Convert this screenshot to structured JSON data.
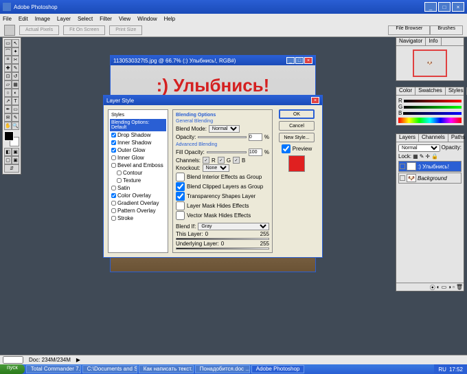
{
  "app": {
    "title": "Adobe Photoshop"
  },
  "menu": [
    "File",
    "Edit",
    "Image",
    "Layer",
    "Select",
    "Filter",
    "View",
    "Window",
    "Help"
  ],
  "optionbar": {
    "btn1": "Actual Pixels",
    "btn2": "Fit On Screen",
    "btn3": "Print Size",
    "tabs": [
      "File Browser",
      "Brushes"
    ]
  },
  "document": {
    "title": "1130530327t5.jpg @ 66.7% (:) Улыбнись!, RGB#)",
    "text": ":) Улыбнись!"
  },
  "dialog": {
    "title": "Layer Style",
    "hdr": "Styles",
    "selected": "Blending Options: Default",
    "items": [
      "Drop Shadow",
      "Inner Shadow",
      "Outer Glow",
      "Inner Glow",
      "Bevel and Emboss",
      "Contour",
      "Texture",
      "Satin",
      "Color Overlay",
      "Gradient Overlay",
      "Pattern Overlay",
      "Stroke"
    ],
    "checked": [
      true,
      true,
      true,
      false,
      false,
      false,
      false,
      false,
      true,
      false,
      false,
      false
    ],
    "blending": {
      "grp": "Blending Options",
      "general": "General Blending",
      "mode_lbl": "Blend Mode:",
      "mode": "Normal",
      "opacity_lbl": "Opacity:",
      "opacity": "0",
      "opacity_pct": "%",
      "advanced": "Advanced Blending",
      "fill_lbl": "Fill Opacity:",
      "fill": "100",
      "channels_lbl": "Channels:",
      "ch_r": "R",
      "ch_g": "G",
      "ch_b": "B",
      "knockout_lbl": "Knockout:",
      "knockout": "None",
      "opt1": "Blend Interior Effects as Group",
      "opt2": "Blend Clipped Layers as Group",
      "opt3": "Transparency Shapes Layer",
      "opt4": "Layer Mask Hides Effects",
      "opt5": "Vector Mask Hides Effects",
      "blendif_lbl": "Blend If:",
      "blendif": "Gray",
      "thislayer": "This Layer:",
      "thislayer_lo": "0",
      "thislayer_hi": "255",
      "underlying": "Underlying Layer:",
      "underlying_lo": "0",
      "underlying_hi": "255"
    },
    "buttons": {
      "ok": "OK",
      "cancel": "Cancel",
      "newstyle": "New Style...",
      "preview": "Preview"
    }
  },
  "panels": {
    "nav": {
      "tabs": [
        "Navigator",
        "Info"
      ]
    },
    "color": {
      "tabs": [
        "Color",
        "Swatches",
        "Styles"
      ]
    },
    "layers": {
      "tabs": [
        "Layers",
        "Channels",
        "Paths"
      ],
      "mode": "Normal",
      "opacity_lbl": "Opacity:",
      "opacity": "",
      "lock": "Lock:",
      "rows": [
        {
          "thumb": "T",
          "name": ":) Улыбнись!",
          "selected": true
        },
        {
          "thumb": "",
          "name": "Background",
          "selected": false
        }
      ]
    }
  },
  "status": {
    "zoom": "",
    "doc": "Doc: 234M/234M"
  },
  "taskbar": {
    "start": "пуск",
    "items": [
      "Total Commander 7.0...",
      "C:\\Documents and Se...",
      "Как написать текст...",
      "Понадобится.doc ...",
      "Adobe Photoshop"
    ],
    "lang": "RU",
    "time": "17:52"
  }
}
